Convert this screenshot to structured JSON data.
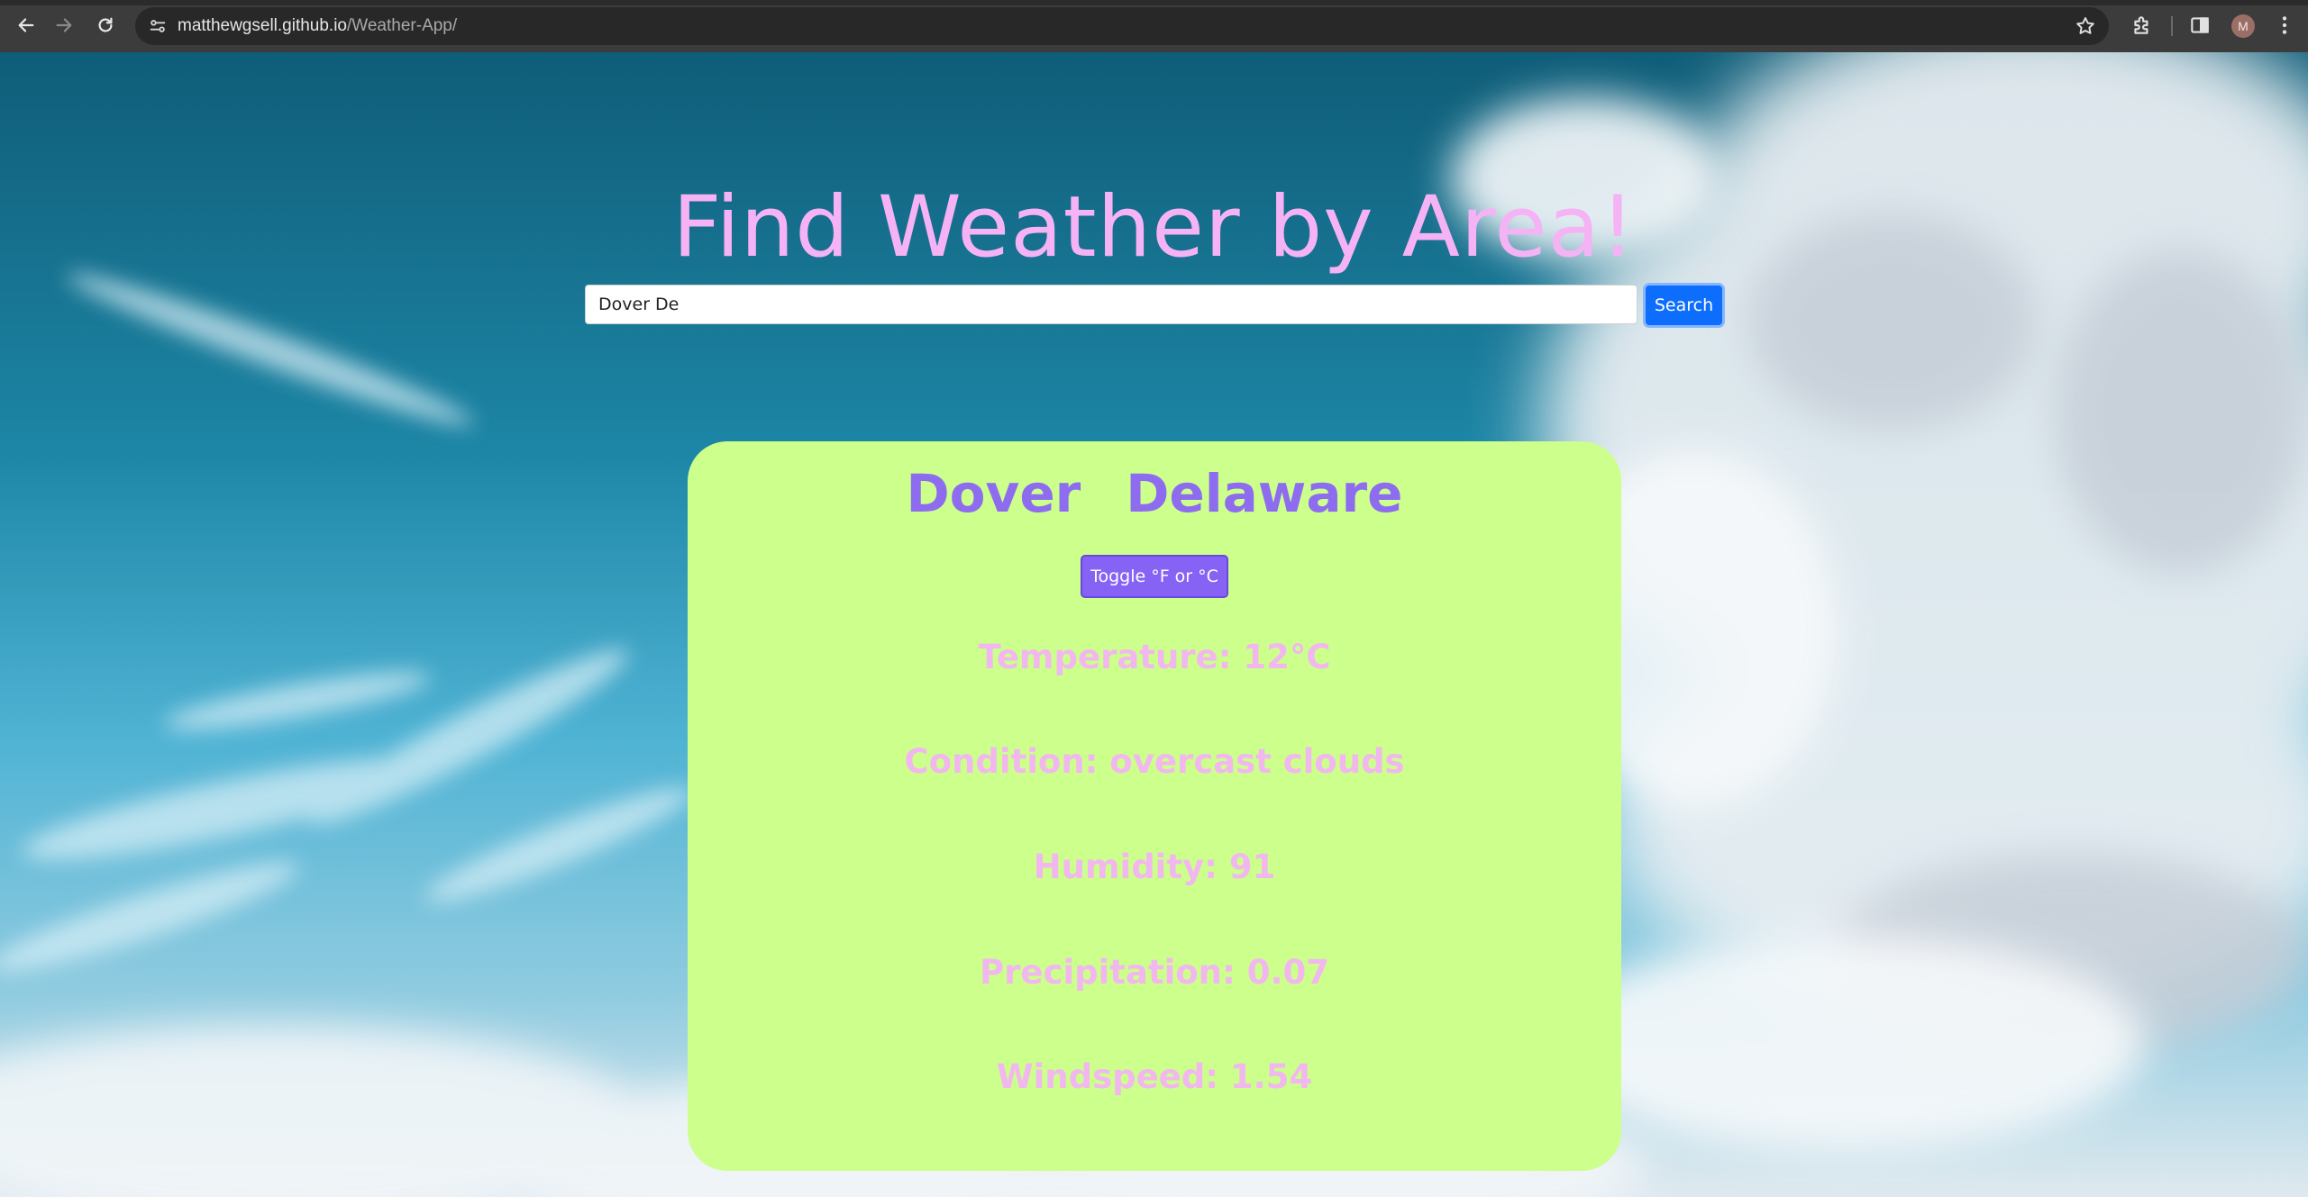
{
  "browser": {
    "url_host": "matthewgsell.github.io",
    "url_path": "/Weather-App/",
    "avatar_initial": "M"
  },
  "page": {
    "title": "Find Weather by Area!"
  },
  "search": {
    "value": "Dover De",
    "button_label": "Search"
  },
  "weather": {
    "city": "Dover",
    "region": "Delaware",
    "toggle_label": "Toggle °F or °C",
    "temperature": "Temperature: 12°C",
    "condition": "Condition: overcast clouds",
    "humidity": "Humidity: 91",
    "precipitation": "Precipitation: 0.07",
    "windspeed": "Windspeed: 1.54"
  },
  "colors": {
    "title": "#f5b3f5",
    "card_bg": "#ccff8c",
    "location_text": "#8d6cf0",
    "stat_text": "#f3b7f0",
    "toggle_bg": "#8663f5",
    "search_btn_bg": "#0d6efd"
  },
  "icons": {
    "back": "arrow-left-icon",
    "forward": "arrow-right-icon",
    "reload": "reload-icon",
    "site_info": "site-settings-icon",
    "bookmark": "star-icon",
    "extensions": "puzzle-icon",
    "side_panel": "side-panel-icon",
    "menu": "kebab-menu-icon"
  }
}
